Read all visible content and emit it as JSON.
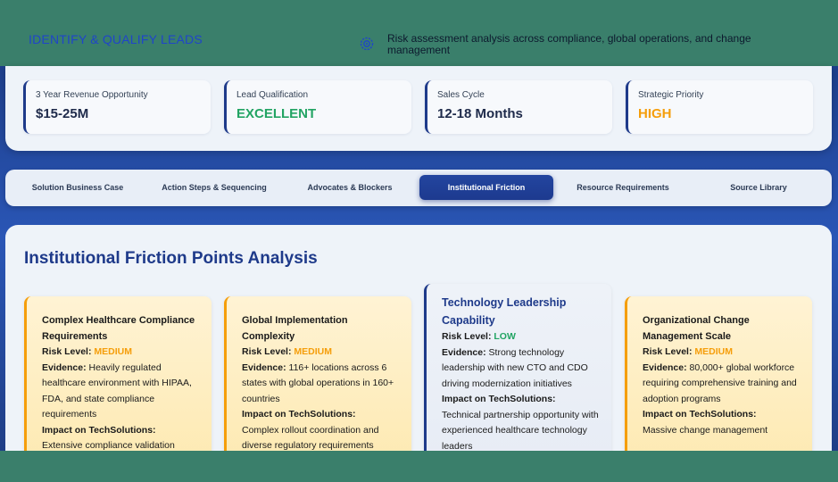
{
  "header": {
    "title": "IDENTIFY & QUALIFY LEADS",
    "icon": "shield-gear-icon",
    "description": "Risk assessment analysis across compliance, global operations, and change management"
  },
  "metrics": [
    {
      "label": "3 Year Revenue Opportunity",
      "value": "$15-25M",
      "color": "#1e2a4a"
    },
    {
      "label": "Lead Qualification",
      "value": "EXCELLENT",
      "color": "#22a463"
    },
    {
      "label": "Sales Cycle",
      "value": "12-18 Months",
      "color": "#1e2a4a"
    },
    {
      "label": "Strategic Priority",
      "value": "HIGH",
      "color": "#f59e0b"
    }
  ],
  "tabs": [
    {
      "label": "Solution Business Case",
      "active": false
    },
    {
      "label": "Action Steps & Sequencing",
      "active": false
    },
    {
      "label": "Advocates & Blockers",
      "active": false
    },
    {
      "label": "Institutional Friction",
      "active": true
    },
    {
      "label": "Resource Requirements",
      "active": false
    },
    {
      "label": "Source Library",
      "active": false
    }
  ],
  "section": {
    "heading": "Institutional Friction Points Analysis",
    "labels": {
      "risk": "Risk Level:",
      "evidence": "Evidence:",
      "impact": "Impact on TechSolutions:"
    },
    "cards": [
      {
        "title": "Complex Healthcare Compliance Requirements",
        "risk": "MEDIUM",
        "evidence": "Heavily regulated healthcare environment with HIPAA, FDA, and state compliance requirements",
        "impact": "Extensive compliance validation"
      },
      {
        "title": "Global Implementation Complexity",
        "risk": "MEDIUM",
        "evidence": "116+ locations across 6 states with global operations in 160+ countries",
        "impact": "Complex rollout coordination and diverse regulatory requirements"
      },
      {
        "title": "Technology Leadership Capability",
        "risk": "LOW",
        "evidence": "Strong technology leadership with new CTO and CDO driving modernization initiatives",
        "impact": "Technical partnership opportunity with experienced healthcare technology leaders"
      },
      {
        "title": "Organizational Change Management Scale",
        "risk": "MEDIUM",
        "evidence": "80,000+ global workforce requiring comprehensive training and adoption programs",
        "impact": "Massive change management"
      }
    ]
  },
  "colors": {
    "brand": "#1e3a8a",
    "medium": "#f59e0b",
    "low": "#22a463",
    "frame": "#3a7f6b"
  }
}
